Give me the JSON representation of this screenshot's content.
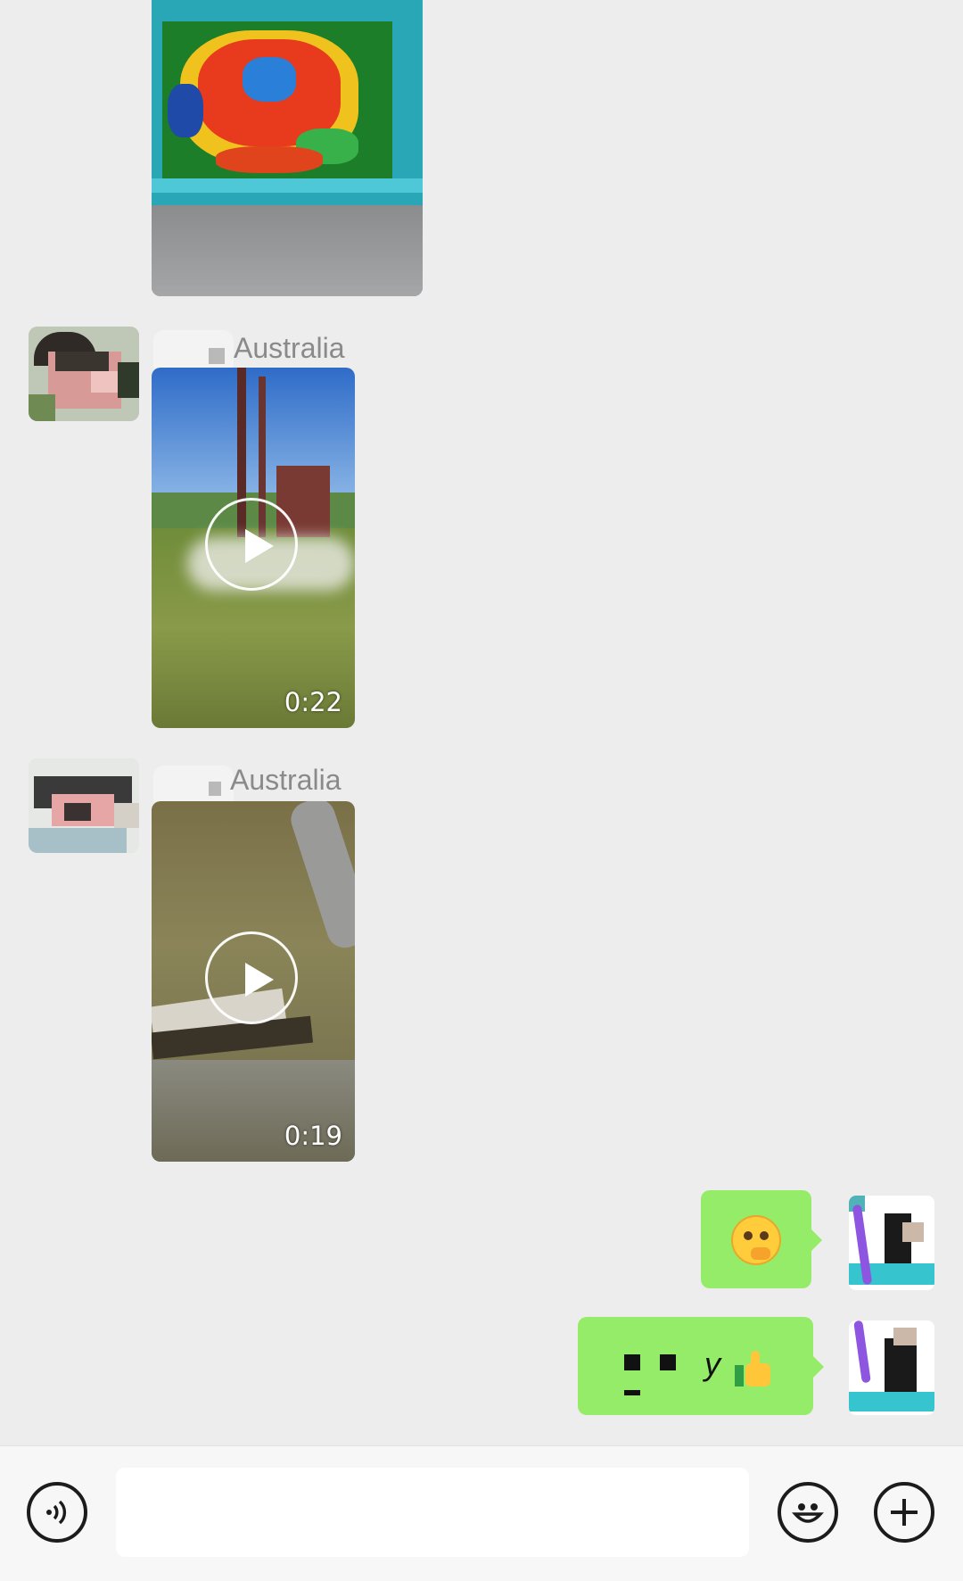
{
  "messages": [
    {
      "type": "image",
      "from": "contact"
    },
    {
      "type": "video",
      "from": "contact",
      "sender_label": "Australia",
      "duration": "0:22"
    },
    {
      "type": "video",
      "from": "contact",
      "sender_label": "Australia",
      "duration": "0:19"
    },
    {
      "type": "emoji",
      "from": "self",
      "icon": "thinking-face-icon"
    },
    {
      "type": "text",
      "from": "self",
      "text": "y",
      "icon": "thumbs-up-icon"
    }
  ],
  "input_bar": {
    "voice_icon": "voice-icon",
    "emoji_icon": "smiley-icon",
    "more_icon": "plus-icon",
    "placeholder": ""
  },
  "colors": {
    "background": "#ededed",
    "self_bubble": "#95ec69",
    "input_bar": "#f7f7f7"
  }
}
